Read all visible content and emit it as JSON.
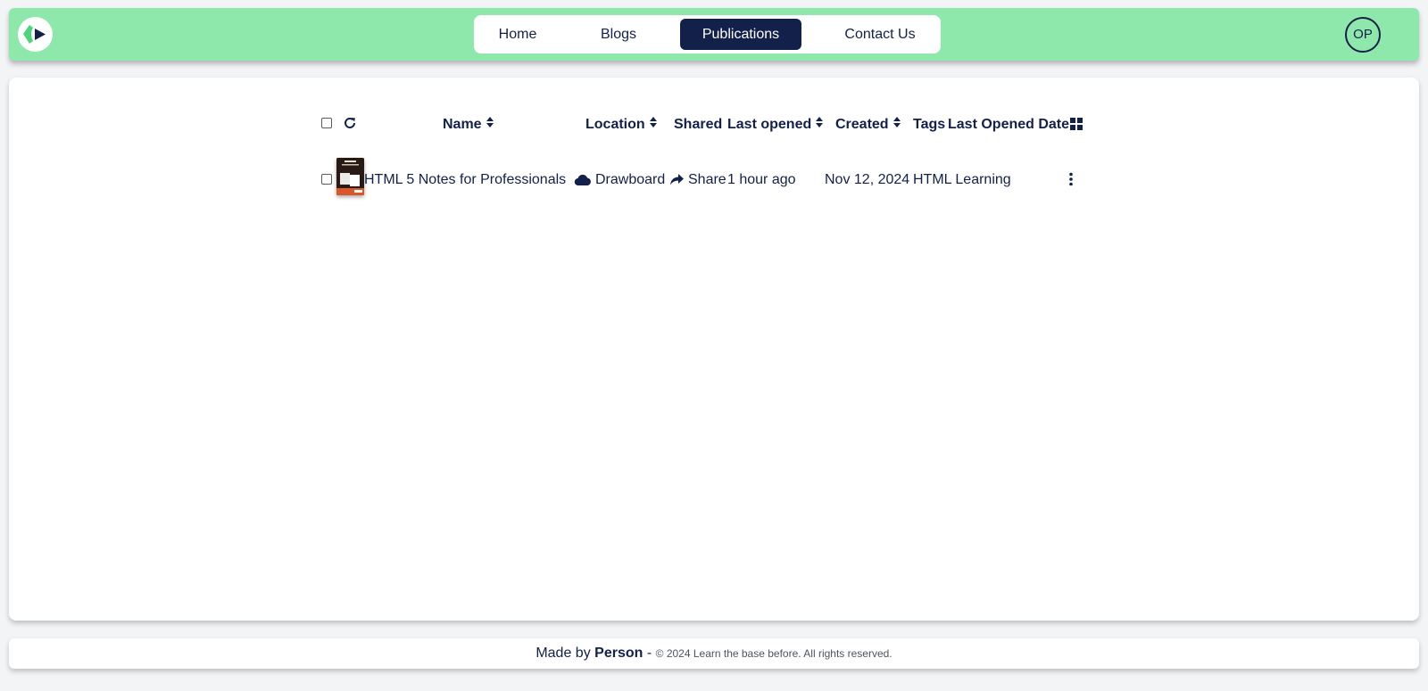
{
  "nav": {
    "items": [
      {
        "label": "Home",
        "active": false
      },
      {
        "label": "Blogs",
        "active": false
      },
      {
        "label": "Publications",
        "active": true
      },
      {
        "label": "Contact Us",
        "active": false
      }
    ]
  },
  "user": {
    "initials": "OP"
  },
  "table": {
    "columns": [
      {
        "label": "Name",
        "sortable": true
      },
      {
        "label": "Location",
        "sortable": true
      },
      {
        "label": "Shared",
        "sortable": false
      },
      {
        "label": "Last opened",
        "sortable": true
      },
      {
        "label": "Created",
        "sortable": true
      },
      {
        "label": "Tags",
        "sortable": false
      },
      {
        "label": "Last Opened Date",
        "sortable": false
      }
    ],
    "rows": [
      {
        "name": "HTML 5 Notes for Professionals",
        "location": "Drawboard",
        "shared": "Share",
        "last_opened": "1 hour ago",
        "created": "Nov 12, 2024",
        "tags": "HTML Learning"
      }
    ]
  },
  "footer": {
    "made_by": "Made by",
    "author": "Person",
    "separator": "-",
    "copyright": "© 2024 Learn the base before. All rights reserved."
  },
  "colors": {
    "header_bg": "#8fe8ab",
    "accent_navy": "#13204a",
    "page_bg": "#f3f4f6"
  }
}
